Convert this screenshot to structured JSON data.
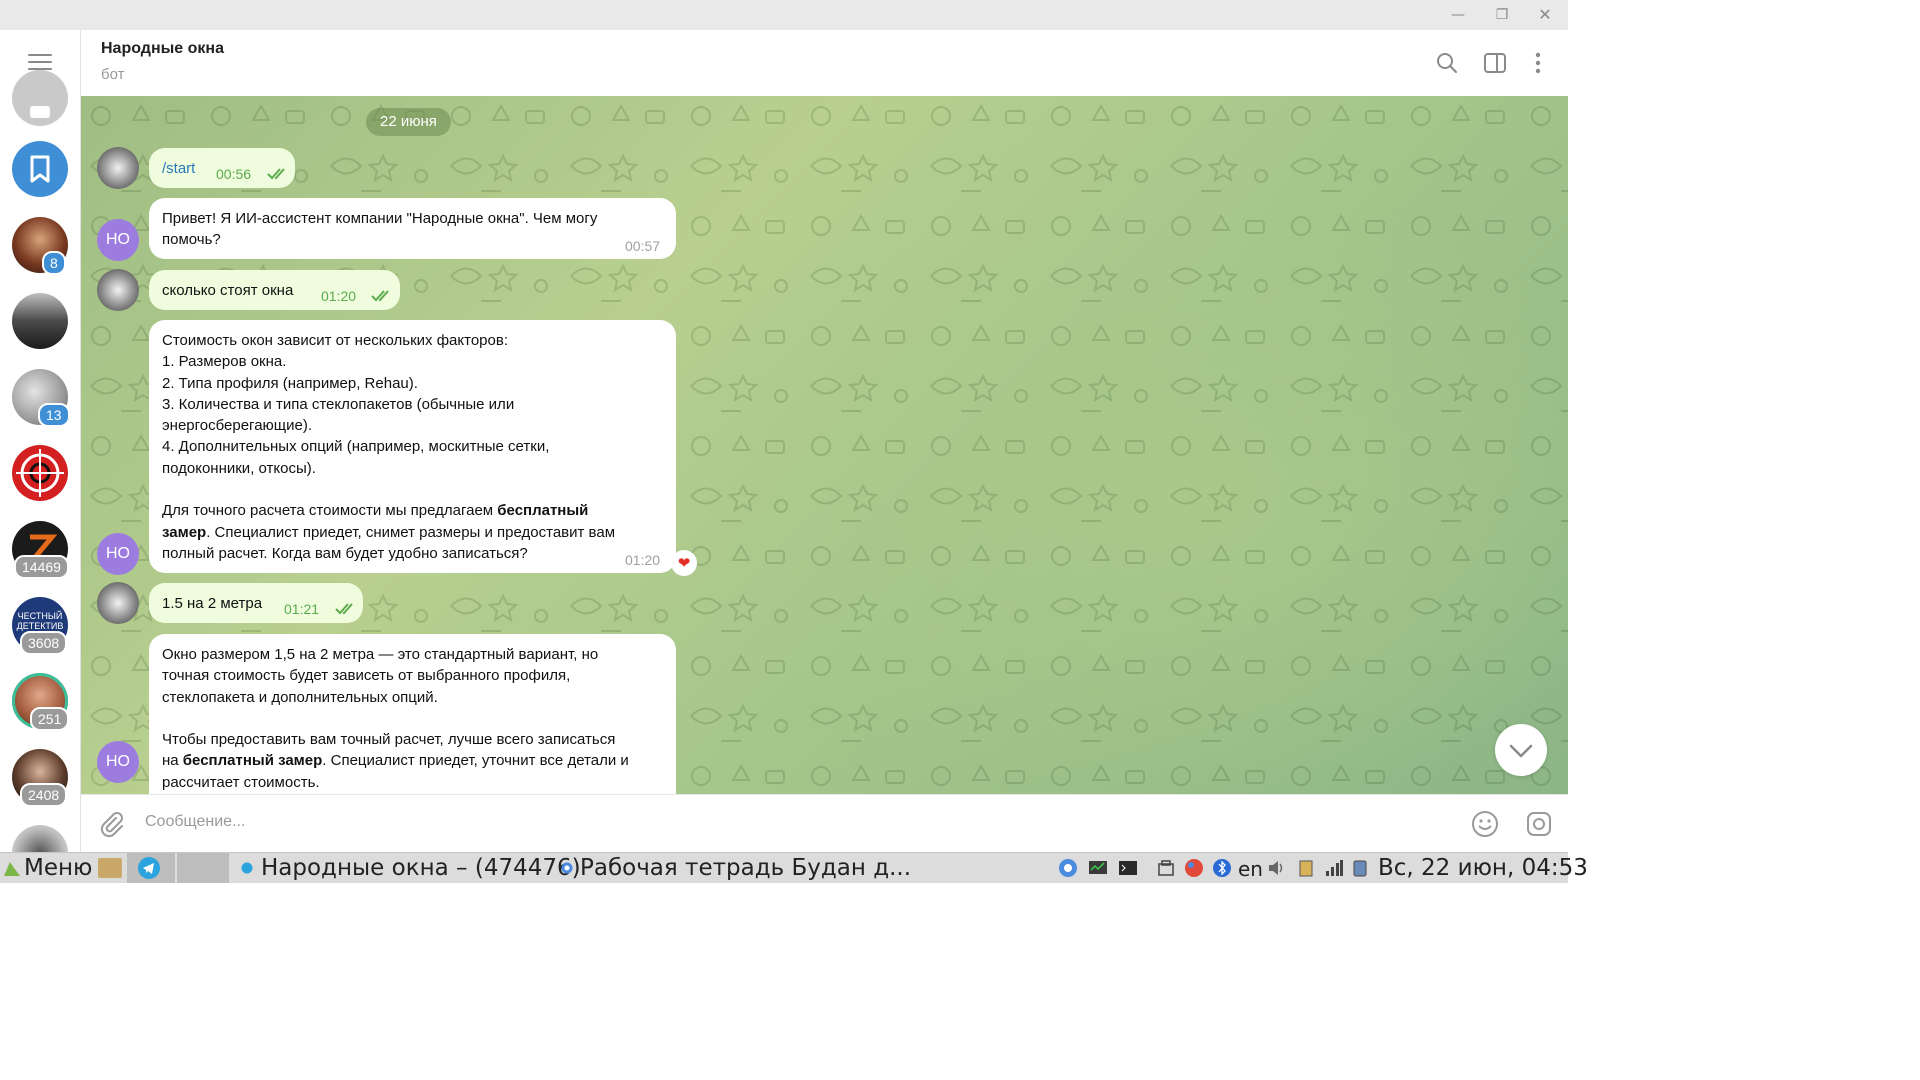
{
  "window": {
    "controls": [
      "minimize",
      "maximize",
      "close"
    ]
  },
  "sidebar": {
    "chats": [
      {
        "name": "folder",
        "badge": ""
      },
      {
        "name": "saved-messages",
        "badge": ""
      },
      {
        "name": "chat-1",
        "badge": "8"
      },
      {
        "name": "chat-2",
        "badge": ""
      },
      {
        "name": "chat-3",
        "badge": "13"
      },
      {
        "name": "chat-4",
        "badge": ""
      },
      {
        "name": "chat-5",
        "badge": "14469"
      },
      {
        "name": "chat-6",
        "label": "ЧЕСТНЫЙ ДЕТЕКТИВ",
        "badge": "3608"
      },
      {
        "name": "chat-7",
        "badge": "251"
      },
      {
        "name": "chat-8",
        "badge": "2408"
      },
      {
        "name": "chat-9",
        "badge": ""
      }
    ]
  },
  "header": {
    "title": "Народные окна",
    "subtitle": "бот"
  },
  "chat": {
    "date": "22 июня",
    "messages": [
      {
        "dir": "out",
        "lines": [
          "/start"
        ],
        "time": "00:56"
      },
      {
        "dir": "in",
        "avatar": "НО",
        "lines": [
          "Привет! Я ИИ-ассистент компании \"Народные окна\". Чем могу",
          "помочь?"
        ],
        "time": "00:57"
      },
      {
        "dir": "out",
        "lines": [
          "сколько стоят окна"
        ],
        "time": "01:20"
      },
      {
        "dir": "in",
        "avatar": "НО",
        "lines": [
          "Стоимость окон зависит от нескольких факторов:",
          "1. Размеров окна.",
          "2. Типа профиля (например, Rehau).",
          "3. Количества и типа стеклопакетов (обычные или",
          "энергосберегающие).",
          "4. Дополнительных опций (например, москитные сетки,",
          "подоконники, откосы).",
          "",
          "Для точного расчета стоимости мы предлагаем ",
          "бесплатный",
          "замер",
          ". Специалист приедет, снимет размеры и предоставит вам",
          "полный расчет. Когда вам будет удобно записаться?"
        ],
        "time": "01:20",
        "reaction": "❤"
      },
      {
        "dir": "out",
        "lines": [
          "1.5 на 2 метра"
        ],
        "time": "01:21"
      },
      {
        "dir": "in",
        "avatar": "НО",
        "lines": [
          "Окно размером 1,5 на 2 метра — это стандартный вариант, но",
          "точная стоимость будет зависеть от выбранного профиля,",
          "стеклопакета и дополнительных опций.",
          "",
          "Чтобы предоставить вам точный расчет, лучше всего записаться",
          "на ",
          "бесплатный замер",
          ". Специалист приедет, уточнит все детали и",
          "рассчитает стоимость."
        ]
      }
    ]
  },
  "composer": {
    "placeholder": "Сообщение..."
  },
  "taskbar": {
    "menu": "Меню",
    "window1": "Народные окна – (474476)",
    "window2": "Рабочая тетрадь Будан д...",
    "lang": "en",
    "clock": "Вс, 22 июн, 04:53"
  },
  "colors": {
    "accent": "#3f8fd6",
    "outgoing_bubble": "#effdde",
    "time_outgoing": "#5dab4f",
    "avatar_ho": "#9d7ce0"
  }
}
